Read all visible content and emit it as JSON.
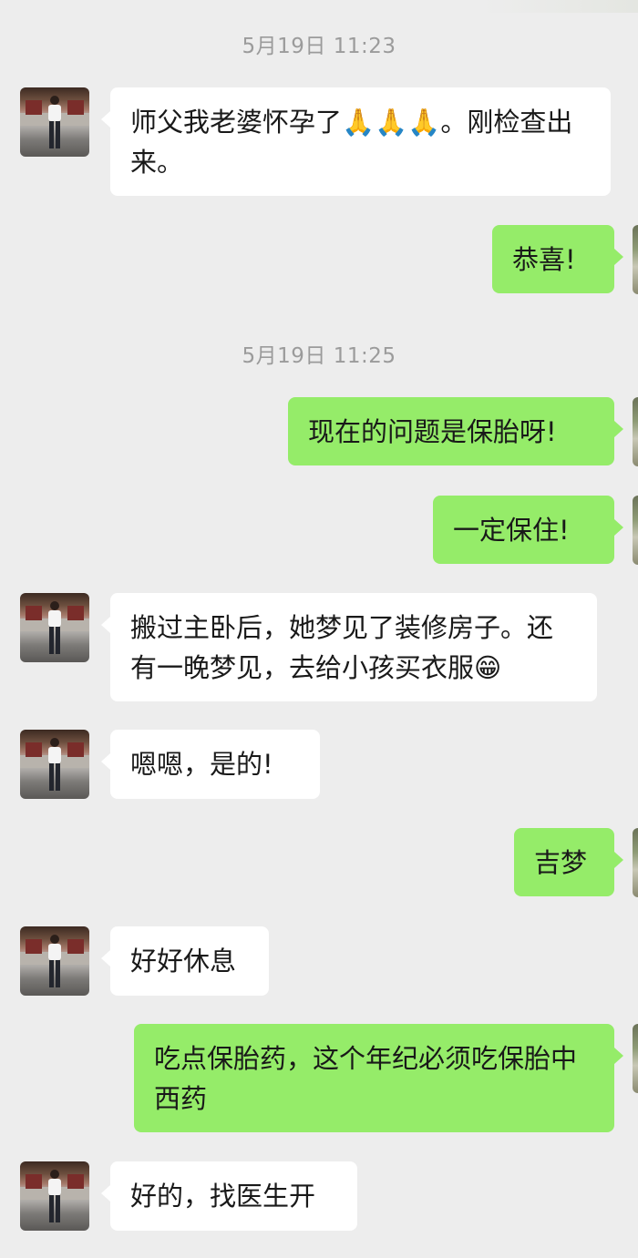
{
  "timestamps": [
    "5月19日 11:23",
    "5月19日 11:25"
  ],
  "messages": [
    {
      "side": "left",
      "text": "师父我老婆怀孕了🙏🙏🙏。刚检查出来。"
    },
    {
      "side": "right",
      "text": "恭喜!"
    },
    {
      "side": "right",
      "text": "现在的问题是保胎呀!"
    },
    {
      "side": "right",
      "text": "一定保住!"
    },
    {
      "side": "left",
      "text": "搬过主卧后，她梦见了装修房子。还有一晚梦见，去给小孩买衣服😁"
    },
    {
      "side": "left",
      "text": "嗯嗯，是的!"
    },
    {
      "side": "right",
      "text": "吉梦"
    },
    {
      "side": "left",
      "text": "好好休息"
    },
    {
      "side": "right",
      "text": "吃点保胎药，这个年纪必须吃保胎中西药"
    },
    {
      "side": "left",
      "text": "好的，找医生开"
    }
  ],
  "colors": {
    "background": "#ededed",
    "bubble_left": "#ffffff",
    "bubble_right": "#95ec69",
    "timestamp_text": "#9b9b9b"
  },
  "icons": {
    "contact_avatar": "avatar-photo",
    "self_avatar": "avatar-photo"
  }
}
